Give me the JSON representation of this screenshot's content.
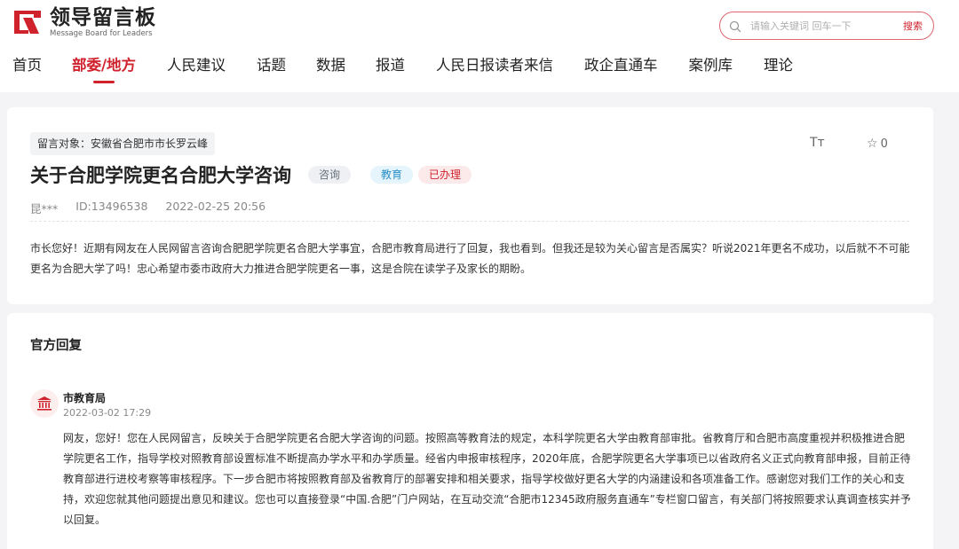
{
  "header": {
    "logo_cn": "领导留言板",
    "logo_en": "Message Board for Leaders",
    "search": {
      "placeholder": "请输入关键词 回车一下",
      "button": "搜索"
    }
  },
  "nav": {
    "items": [
      {
        "label": "首页",
        "active": false
      },
      {
        "label": "部委/地方",
        "active": true
      },
      {
        "label": "人民建议",
        "active": false
      },
      {
        "label": "话题",
        "active": false
      },
      {
        "label": "数据",
        "active": false
      },
      {
        "label": "报道",
        "active": false
      },
      {
        "label": "人民日报读者来信",
        "active": false
      },
      {
        "label": "政企直通车",
        "active": false
      },
      {
        "label": "案例库",
        "active": false
      },
      {
        "label": "理论",
        "active": false
      }
    ]
  },
  "message": {
    "target": "留言对象：安徽省合肥市市长罗云峰",
    "font_tool": "Tт",
    "favorites": "0",
    "title": "关于合肥学院更名合肥大学咨询",
    "tags": [
      "咨询",
      "教育",
      "已办理"
    ],
    "author": "昆***",
    "id": "ID:13496538",
    "time": "2022-02-25 20:56",
    "content": "市长您好！近期有网友在人民网留言咨询合肥肥学院更名合肥大学事宜，合肥市教育局进行了回复，我也看到。但我还是较为关心留言是否属实？听说2021年更名不成功，以后就不不可能更名为合肥大学了吗！忠心希望市委市政府大力推进合肥学院更名一事，这是合院在读学子及家长的期盼。"
  },
  "official": {
    "section_title": "官方回复",
    "org": "市教育局",
    "time": "2022-03-02 17:29",
    "reply": "网友，您好！您在人民网留言，反映关于合肥学院更名合肥大学咨询的问题。按照高等教育法的规定，本科学院更名大学由教育部审批。省教育厅和合肥市高度重视并积极推进合肥学院更名工作，指导学校对照教育部设置标准不断提高办学水平和办学质量。经省内申报审核程序，2020年底，合肥学院更名大学事项已以省政府名义正式向教育部申报，目前正待教育部进行进校考察等审核程序。下一步合肥市将按照教育部及省教育厅的部署安排和相关要求，指导学校做好更名大学的内涵建设和各项准备工作。感谢您对我们工作的关心和支持，欢迎您就其他问题提出意见和建议。您也可以直接登录“中国.合肥”门户网站，在互动交流“合肥市12345政府服务直通车”专栏窗口留言，有关部门将按照要求认真调查核实并予以回复。"
  },
  "colors": {
    "brand": "#d0222d",
    "tag_blue": "#2a8fc7",
    "tag_gray": "#66707a"
  }
}
